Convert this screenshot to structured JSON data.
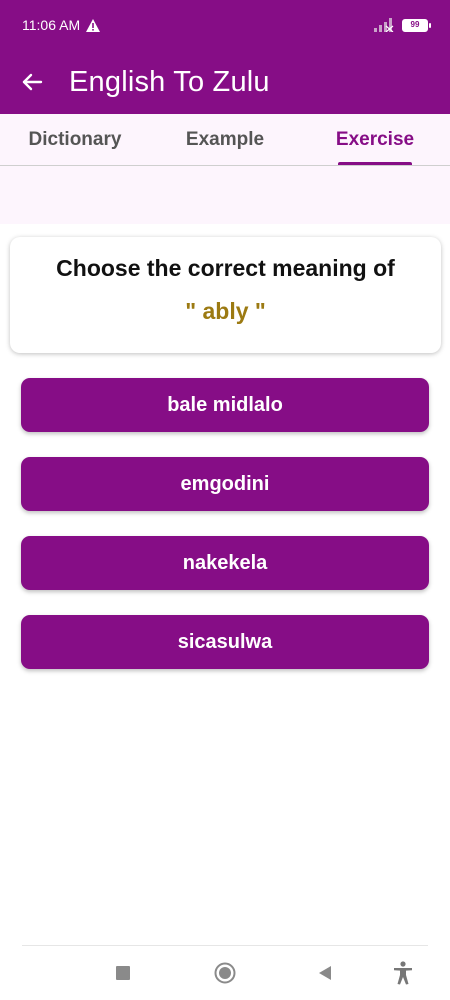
{
  "status_bar": {
    "time": "11:06 AM",
    "battery": "99",
    "icons": [
      "warning-icon",
      "signal-icon",
      "battery-icon"
    ]
  },
  "app_bar": {
    "title": "English To Zulu",
    "back_icon": "arrow-left-icon"
  },
  "tabs": [
    {
      "label": "Dictionary",
      "active": false
    },
    {
      "label": "Example",
      "active": false
    },
    {
      "label": "Exercise",
      "active": true
    }
  ],
  "question": {
    "prompt": "Choose the correct meaning of",
    "word": "\" ably \""
  },
  "options": [
    {
      "label": "bale midlalo"
    },
    {
      "label": "emgodini"
    },
    {
      "label": "nakekela"
    },
    {
      "label": "sicasulwa"
    }
  ],
  "nav_bar": {
    "icons": [
      "recents-square-icon",
      "home-circle-icon",
      "back-triangle-icon",
      "accessibility-icon"
    ]
  },
  "colors": {
    "primary": "#860D86",
    "word_accent": "#9C7A12",
    "tab_background": "#FDF5FD"
  }
}
